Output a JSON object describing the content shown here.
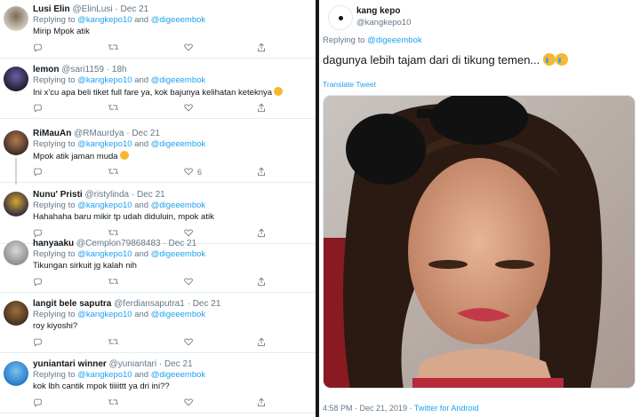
{
  "replies": [
    {
      "name": "Lusi Elin",
      "handle": "@ElinLusi",
      "sep": "·",
      "time": "Dec 21",
      "replying_prefix": "Replying to ",
      "mention1": "@kangkepo10",
      "and": " and ",
      "mention2": "@digeeembok",
      "text": "Mirip Mpok atik",
      "reply_count": "",
      "retweet_count": "",
      "like_count": "",
      "avatar_colors": [
        "#d9d0c4",
        "#7a6a58"
      ]
    },
    {
      "name": "lemon",
      "handle": "@sari1159",
      "sep": "·",
      "time": "18h",
      "replying_prefix": "Replying to ",
      "mention1": "@kangkepo10",
      "and": " and ",
      "mention2": "@digeeembok",
      "text": "Ini x'cu apa beli tiket full fare ya, kok bajunya kelihatan keteknya",
      "reply_count": "",
      "retweet_count": "",
      "like_count": "",
      "avatar_colors": [
        "#1c1c2a",
        "#6b5fa8"
      ]
    },
    {
      "name": "RiMauAn",
      "handle": "@RMaurdya",
      "sep": "·",
      "time": "Dec 21",
      "replying_prefix": "Replying to ",
      "mention1": "@kangkepo10",
      "and": " and ",
      "mention2": "@digeeembok",
      "text": "Mpok atik jaman muda",
      "reply_count": "",
      "retweet_count": "",
      "like_count": "6",
      "avatar_colors": [
        "#3a2a20",
        "#b47a52"
      ]
    },
    {
      "name": "Nunu' Pristi",
      "handle": "@ristylinda",
      "sep": "·",
      "time": "Dec 21",
      "replying_prefix": "Replying to ",
      "mention1": "@kangkepo10",
      "and": " and ",
      "mention2": "@digeeembok",
      "text": "Hahahaha baru mikir tp udah diduluin, mpok atik",
      "reply_count": "",
      "retweet_count": "",
      "like_count": "",
      "avatar_colors": [
        "#2c2a3e",
        "#d4a72c"
      ]
    },
    {
      "name": "hanyaaku",
      "handle": "@Cemplon79868483",
      "sep": "·",
      "time": "Dec 21",
      "replying_prefix": "Replying to ",
      "mention1": "@kangkepo10",
      "and": " and ",
      "mention2": "@digeeembok",
      "text": "Tikungan sirkuit jg kalah nih",
      "reply_count": "",
      "retweet_count": "",
      "like_count": "",
      "avatar_colors": [
        "#8a8a8a",
        "#d8d8d8"
      ]
    },
    {
      "name": "langit bele saputra",
      "handle": "@ferdiansaputra1",
      "sep": "·",
      "time": "Dec 21",
      "replying_prefix": "Replying to ",
      "mention1": "@kangkepo10",
      "and": " and ",
      "mention2": "@digeeembok",
      "text": "roy kiyoshi?",
      "reply_count": "",
      "retweet_count": "",
      "like_count": "",
      "avatar_colors": [
        "#3a2e24",
        "#a0703c"
      ]
    },
    {
      "name": "yuniantari winner",
      "handle": "@yuniantari",
      "sep": "·",
      "time": "Dec 21",
      "replying_prefix": "Replying to ",
      "mention1": "@kangkepo10",
      "and": " and ",
      "mention2": "@digeeembok",
      "text": "kok lbh cantik mpok tiiiittt ya dri ini??",
      "reply_count": "",
      "retweet_count": "",
      "like_count": "",
      "avatar_colors": [
        "#1f78c8",
        "#7ec0f0"
      ]
    }
  ],
  "main_tweet": {
    "name": "kang kepo",
    "handle": "@kangkepo10",
    "replying_prefix": "Replying to ",
    "mention": "@digeeembok",
    "text": "dagunya lebih tajam dari di tikung temen...",
    "translate": "Translate Tweet",
    "time": "4:58 PM",
    "sep1": " · ",
    "date": "Dec 21, 2019",
    "sep2": " · ",
    "source": "Twitter for Android"
  },
  "colors": {
    "link": "#1da1f2",
    "muted": "#657786",
    "divider": "#15181c"
  },
  "icons": [
    "reply-icon",
    "retweet-icon",
    "like-icon",
    "share-icon",
    "crying-face-emoji"
  ]
}
